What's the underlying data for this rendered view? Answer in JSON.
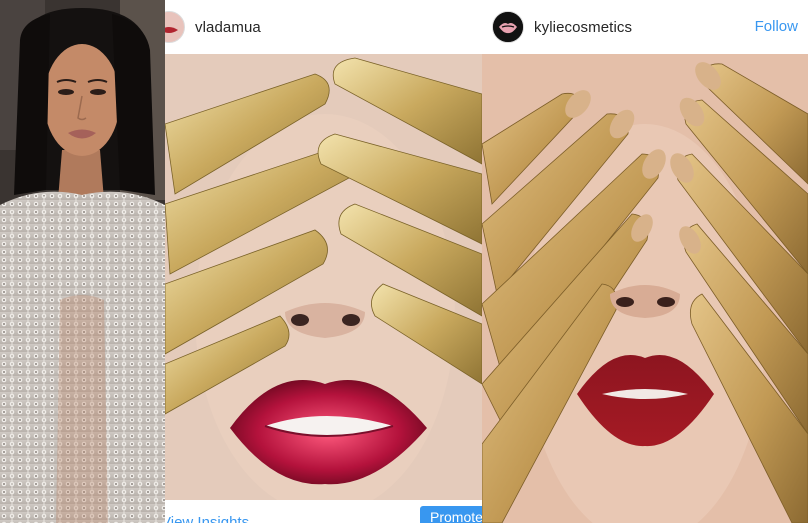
{
  "left_photo": {
    "icon": "celebrity-photo"
  },
  "middle_post": {
    "username": "vladamua",
    "view_insights": "View Insights",
    "promote": "Promote"
  },
  "right_post": {
    "username": "kyliecosmetics",
    "follow": "Follow"
  },
  "colors": {
    "link_blue": "#3897f0",
    "text_dark": "#262626"
  }
}
